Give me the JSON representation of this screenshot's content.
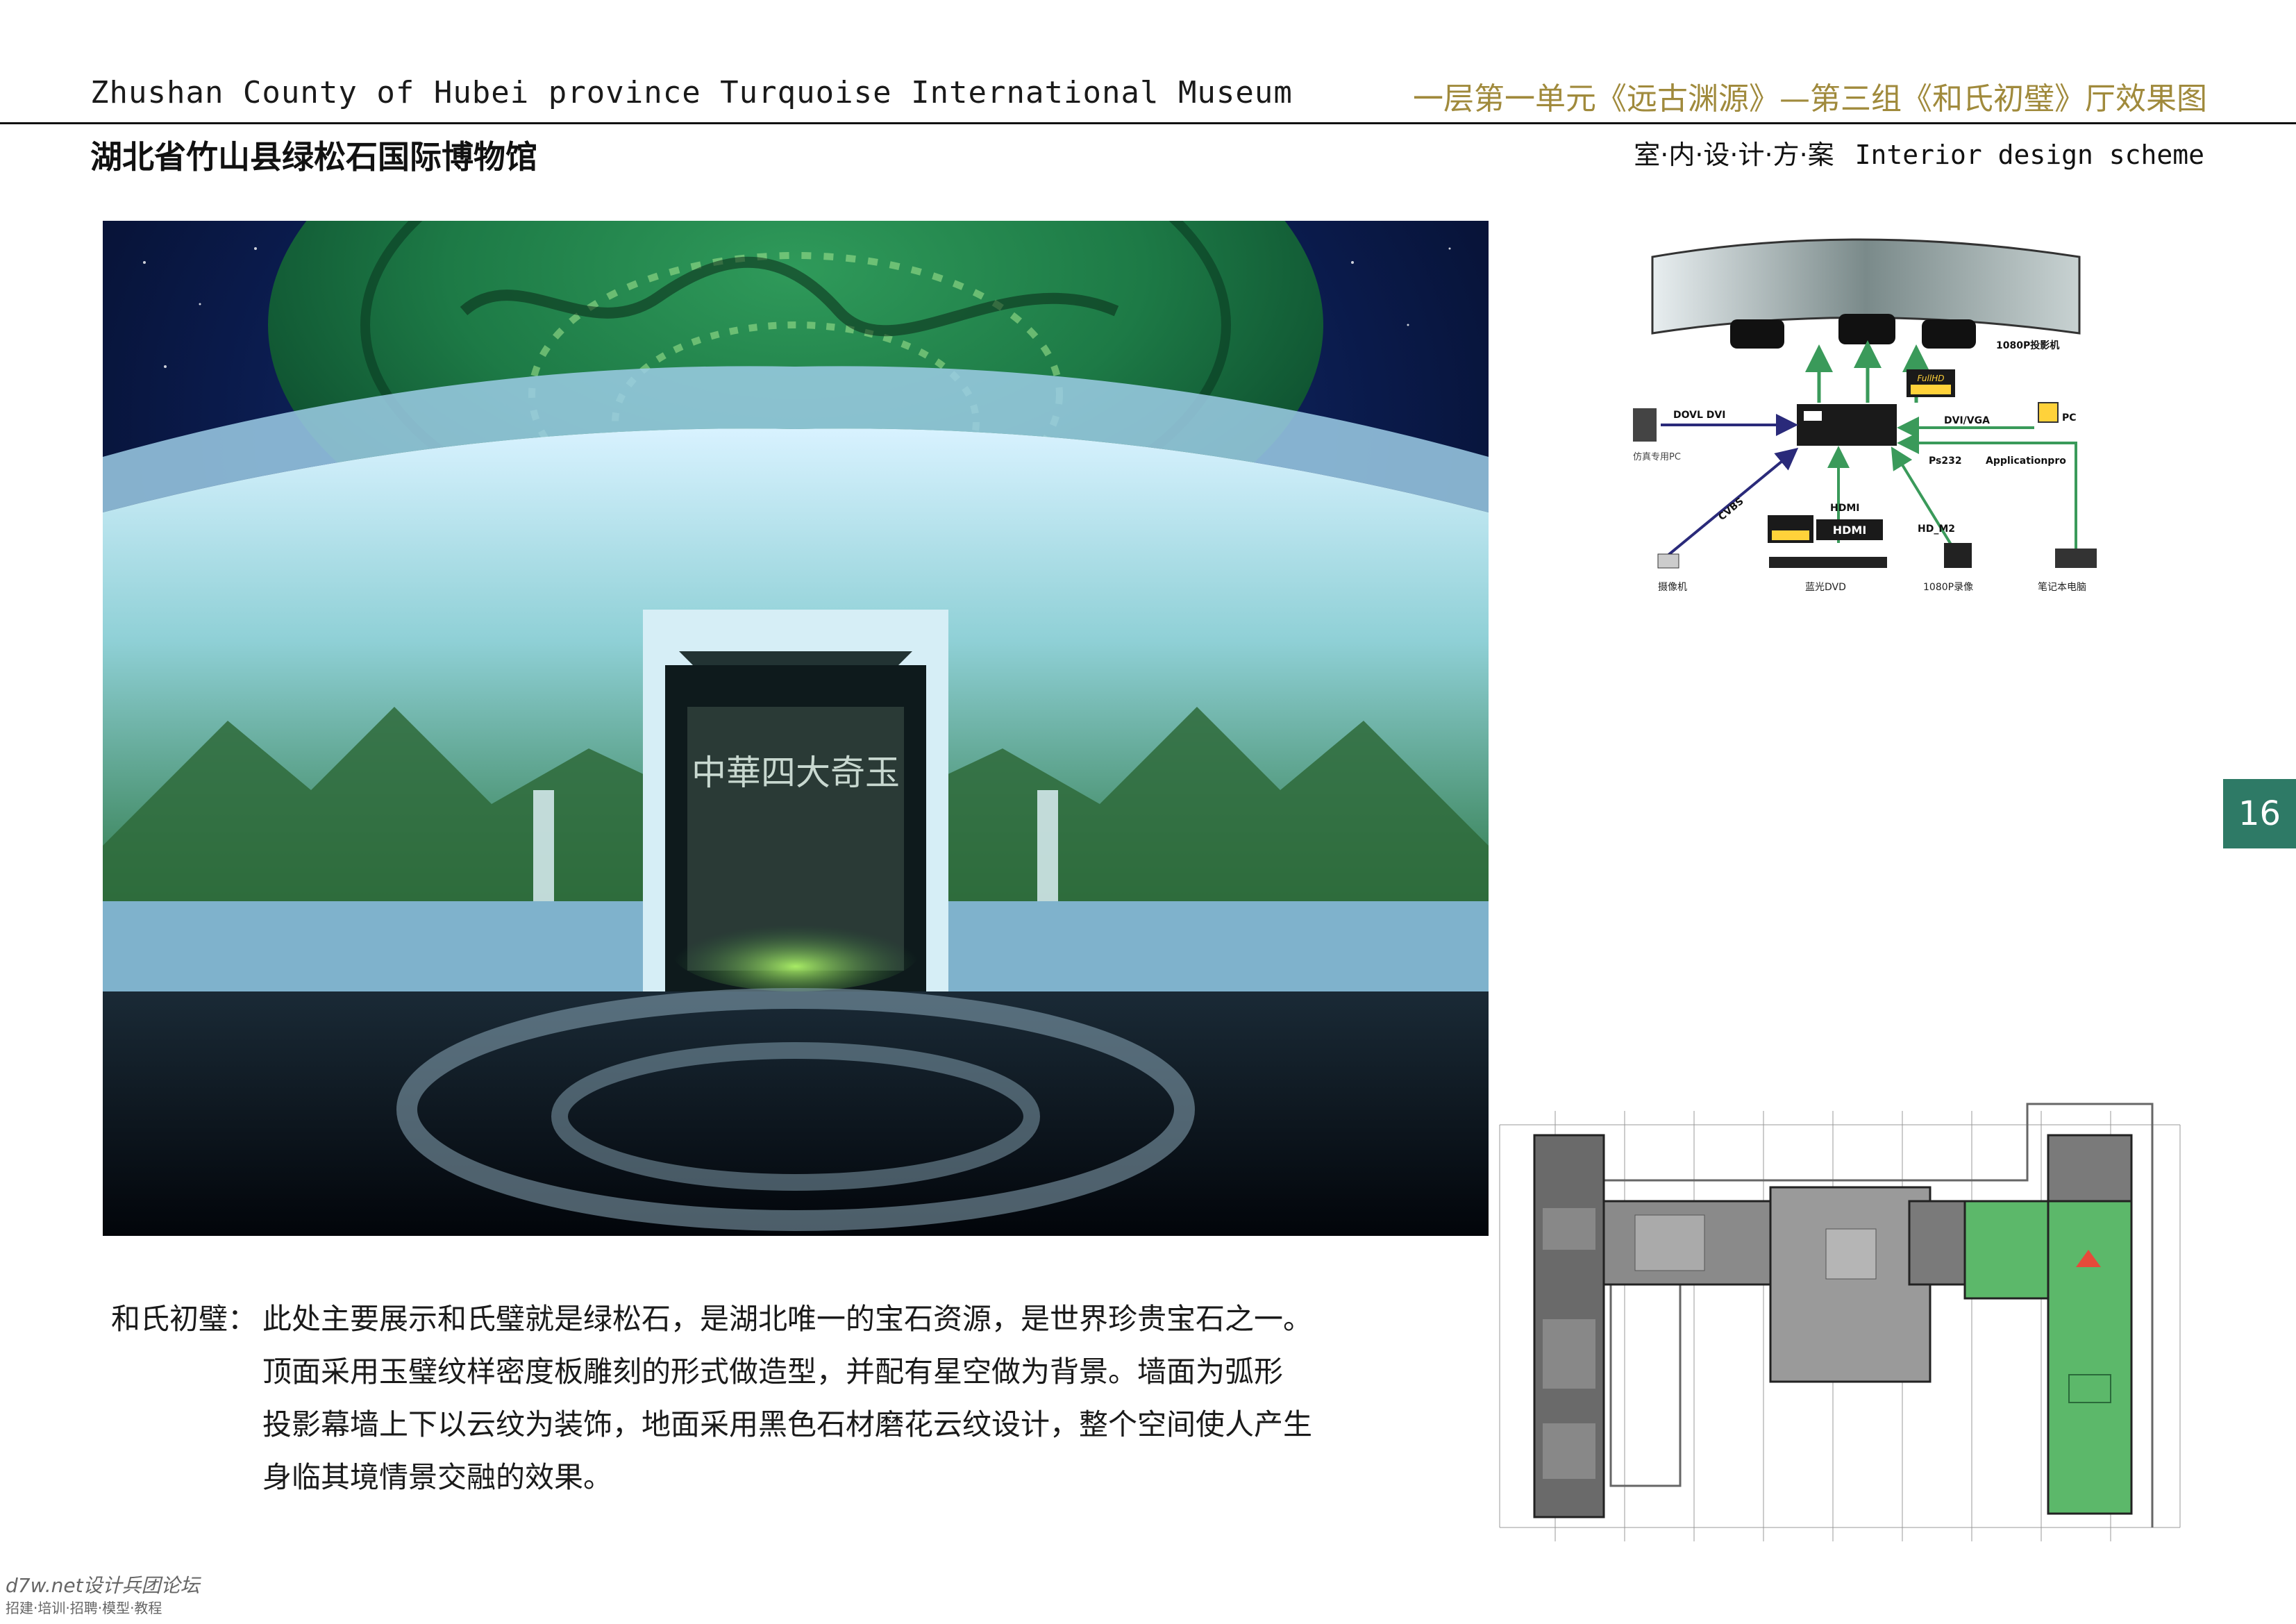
{
  "header": {
    "title_en": "Zhushan County of Hubei province Turquoise International Museum",
    "section_cn": "一层第一单元《远古渊源》—第三组《和氏初璧》厅效果图",
    "title_cn": "湖北省竹山县绿松石国际博物馆",
    "scheme_cn": "室·内·设·计·方·案",
    "scheme_en": "Interior design scheme"
  },
  "page_number": "16",
  "render": {
    "wall_inscription": "中華四大奇玉"
  },
  "caption": {
    "lead": "和氏初璧：",
    "lines": [
      "此处主要展示和氏璧就是绿松石，是湖北唯一的宝石资源，是世界珍贵宝石之一。",
      "顶面采用玉璧纹样密度板雕刻的形式做造型，并配有星空做为背景。墙面为弧形",
      "投影幕墙上下以云纹为装饰，地面采用黑色石材磨花云纹设计，整个空间使人产生",
      "身临其境情景交融的效果。"
    ]
  },
  "diagram": {
    "projector_label": "1080P投影机",
    "dvi_label": "DOVL DVI",
    "pc_left_label": "仿真专用PC",
    "dvi_vga_label": "DVI/VGA",
    "pc_right_label": "PC",
    "ps232_label": "Ps232",
    "app_label": "Applicationpro",
    "cvbs_label": "CVBS",
    "hdmi_label": "HDMI",
    "hdm2_label": "HD_M2",
    "fullhd_label": "FullHD",
    "hdmi_logo": "HDMI",
    "camera_label": "摄像机",
    "dvd_label": "蓝光DVD",
    "recorder_label": "1080P录像",
    "laptop_label": "笔记本电脑"
  },
  "watermark": {
    "site": "d7w.net设计兵团论坛",
    "tagline": "招建·培训·招聘·模型·教程"
  }
}
